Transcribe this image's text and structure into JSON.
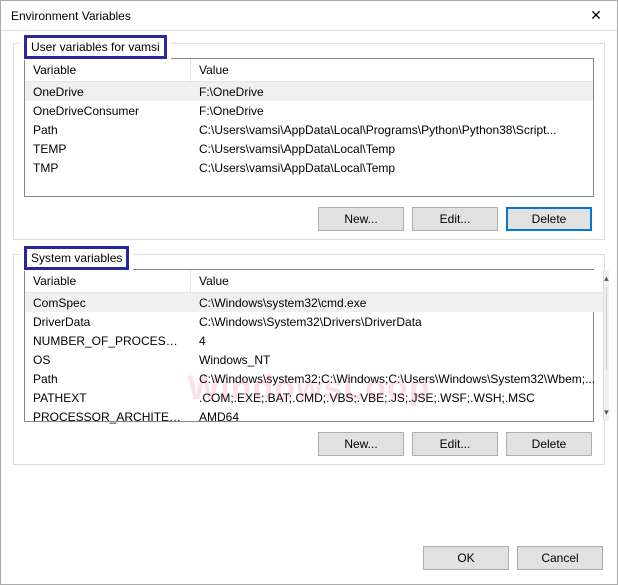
{
  "window": {
    "title": "Environment Variables",
    "close_glyph": "✕"
  },
  "user_section": {
    "legend": "User variables for vamsi",
    "columns": {
      "name": "Variable",
      "value": "Value"
    },
    "rows": [
      {
        "name": "OneDrive",
        "value": "F:\\OneDrive"
      },
      {
        "name": "OneDriveConsumer",
        "value": "F:\\OneDrive"
      },
      {
        "name": "Path",
        "value": "C:\\Users\\vamsi\\AppData\\Local\\Programs\\Python\\Python38\\Script..."
      },
      {
        "name": "TEMP",
        "value": "C:\\Users\\vamsi\\AppData\\Local\\Temp"
      },
      {
        "name": "TMP",
        "value": "C:\\Users\\vamsi\\AppData\\Local\\Temp"
      }
    ],
    "buttons": {
      "new": "New...",
      "edit": "Edit...",
      "delete": "Delete"
    }
  },
  "system_section": {
    "legend": "System variables",
    "columns": {
      "name": "Variable",
      "value": "Value"
    },
    "rows": [
      {
        "name": "ComSpec",
        "value": "C:\\Windows\\system32\\cmd.exe"
      },
      {
        "name": "DriverData",
        "value": "C:\\Windows\\System32\\Drivers\\DriverData"
      },
      {
        "name": "NUMBER_OF_PROCESSORS",
        "value": "4"
      },
      {
        "name": "OS",
        "value": "Windows_NT"
      },
      {
        "name": "Path",
        "value": "C:\\Windows\\system32;C:\\Windows;C:\\Users\\Windows\\System32\\Wbem;..."
      },
      {
        "name": "PATHEXT",
        "value": ".COM;.EXE;.BAT;.CMD;.VBS;.VBE;.JS;.JSE;.WSF;.WSH;.MSC"
      },
      {
        "name": "PROCESSOR_ARCHITECTURE",
        "value": "AMD64"
      }
    ],
    "buttons": {
      "new": "New...",
      "edit": "Edit...",
      "delete": "Delete"
    }
  },
  "footer": {
    "ok": "OK",
    "cancel": "Cancel"
  },
  "watermark": "WindowsLoop"
}
